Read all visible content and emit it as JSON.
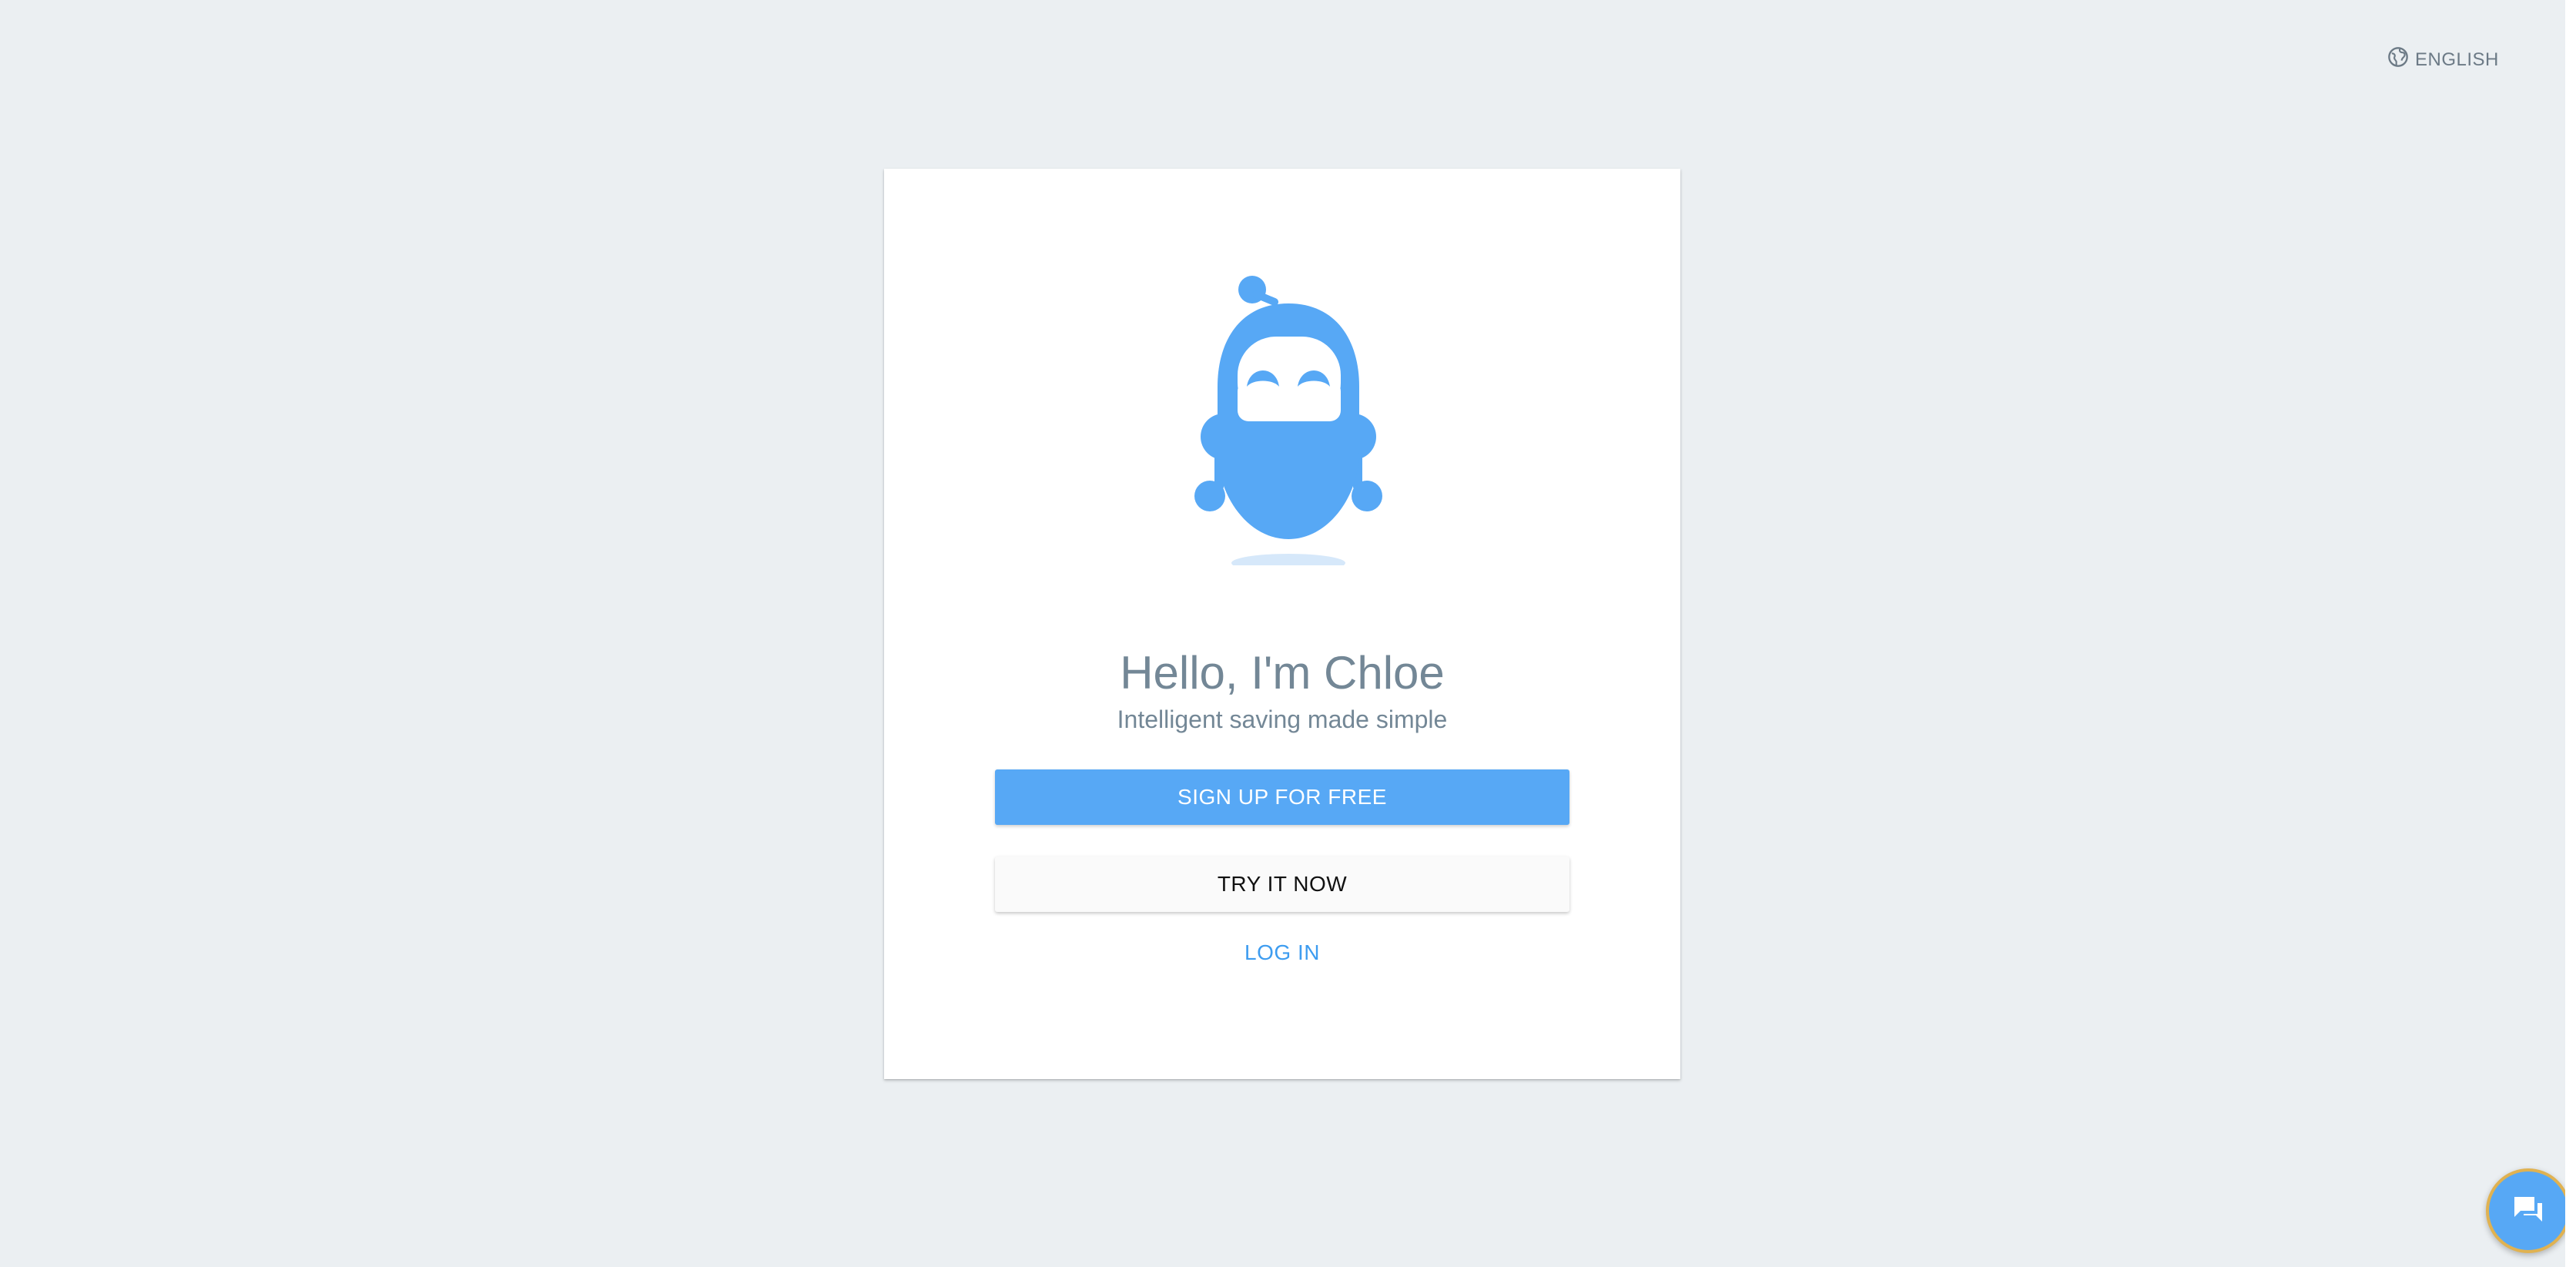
{
  "header": {
    "language_label": "ENGLISH",
    "language_icon": "globe-icon"
  },
  "card": {
    "mascot_icon": "robot-mascot",
    "greeting": "Hello, I'm Chloe",
    "tagline": "Intelligent saving made simple",
    "signup_label": "SIGN UP FOR FREE",
    "try_label": "TRY IT NOW",
    "login_label": "LOG IN"
  },
  "chat": {
    "icon": "chat-icon"
  },
  "colors": {
    "background": "#ebeff2",
    "accent": "#57a8f5",
    "link": "#3d9cf0",
    "text_muted": "#738796",
    "fab_border": "#e0b251"
  }
}
